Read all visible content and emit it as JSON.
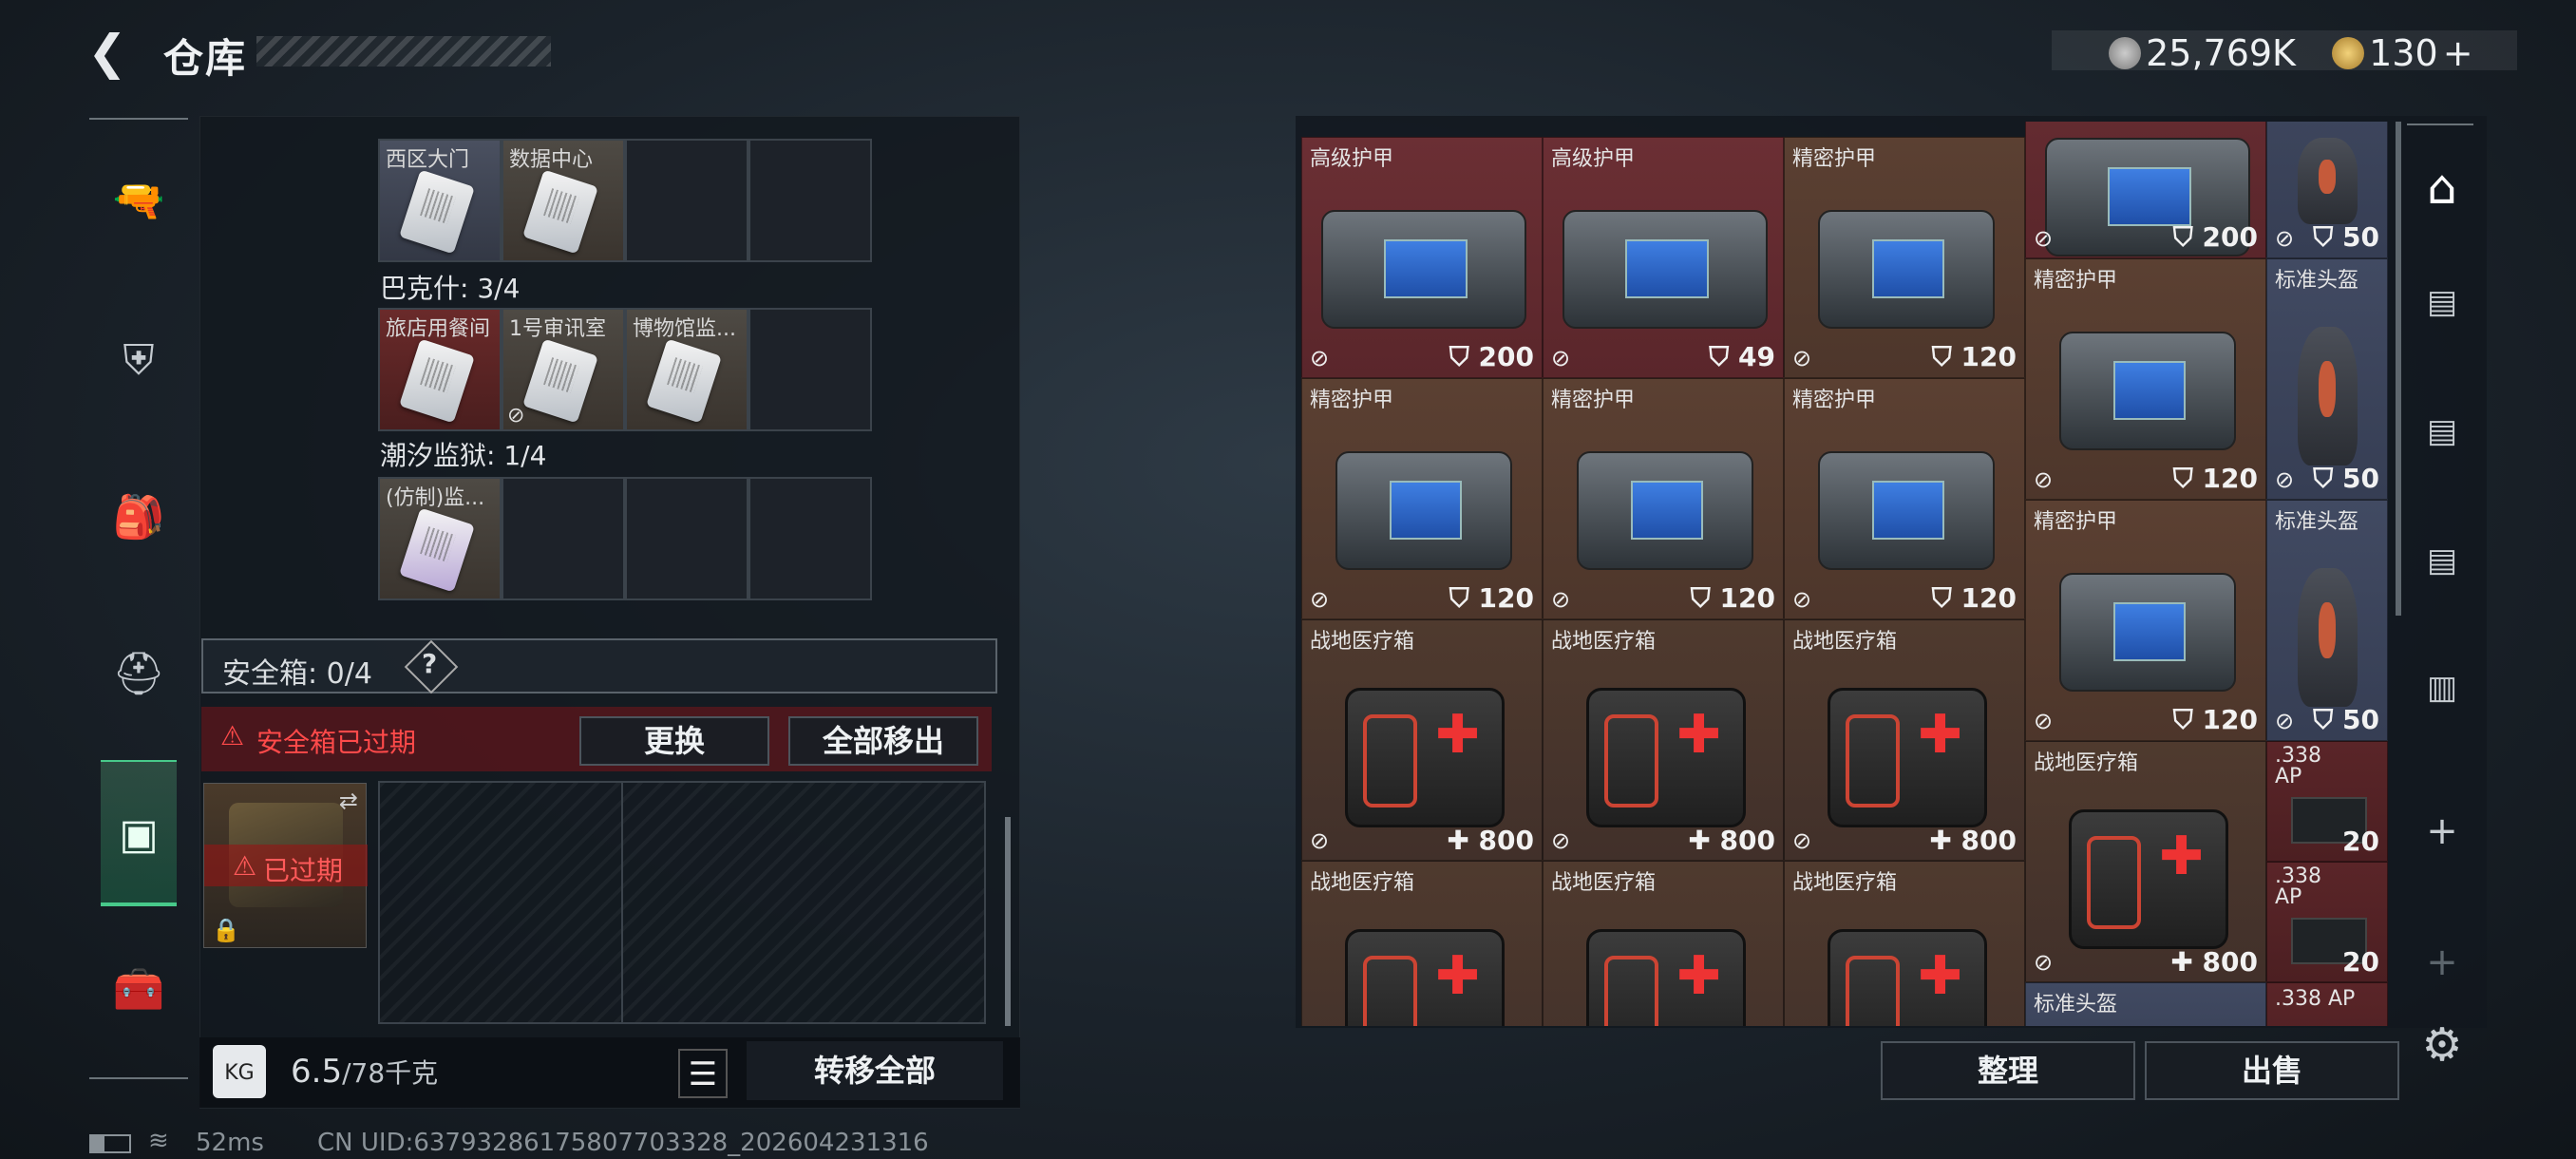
{
  "header": {
    "back_icon": "back-arrow-icon",
    "title": "仓库",
    "currency1": "25,769K",
    "currency2": "130",
    "currency2_add": "+"
  },
  "left_nav": {
    "items": [
      {
        "icon": "gun-icon",
        "glyph": "🔫"
      },
      {
        "icon": "armor-vest-icon",
        "glyph": "⛨"
      },
      {
        "icon": "backpack-icon",
        "glyph": "🎒"
      },
      {
        "icon": "helmet-icon",
        "glyph": "⛑"
      },
      {
        "icon": "safe-box-icon",
        "glyph": "▣"
      },
      {
        "icon": "toolbox-icon",
        "glyph": "🧰"
      }
    ]
  },
  "keycards": {
    "top_slots": [
      "西区大门",
      "数据中心"
    ],
    "group2_label": "巴克什: 3/4",
    "group2_slots": [
      "旅店用餐间",
      "1号审讯室",
      "博物馆监..."
    ],
    "group3_label": "潮汐监狱: 1/4",
    "group3_slots": [
      "(仿制)监..."
    ]
  },
  "safebox": {
    "label": "安全箱: 0/4",
    "help": "?",
    "expired_warning": "安全箱已过期",
    "replace_button": "更换",
    "move_all_button": "全部移出",
    "expired_badge": "已过期"
  },
  "footer_left": {
    "weight_value": "6.5",
    "weight_max": "/78千克",
    "transfer_all": "转移全部"
  },
  "footer_right": {
    "sort_button": "整理",
    "sell_button": "出售"
  },
  "status": {
    "ping": "52ms",
    "uid": "CN UID:63793286175807703328_202604231316"
  },
  "storage_items": [
    {
      "name": "高级护甲",
      "value": "200",
      "kind": "armor"
    },
    {
      "name": "高级护甲",
      "value": "49",
      "kind": "armor"
    },
    {
      "name": "精密护甲",
      "value": "120",
      "kind": "armor2"
    },
    {
      "name": "精密护甲",
      "value": "120",
      "kind": "armor2"
    },
    {
      "name": "精密护甲",
      "value": "120",
      "kind": "armor2"
    },
    {
      "name": "精密护甲",
      "value": "120",
      "kind": "armor2"
    },
    {
      "name": "战地医疗箱",
      "value": "800",
      "kind": "med"
    },
    {
      "name": "战地医疗箱",
      "value": "800",
      "kind": "med"
    },
    {
      "name": "战地医疗箱",
      "value": "800",
      "kind": "med"
    },
    {
      "name": "战地医疗箱",
      "value": "",
      "kind": "med"
    },
    {
      "name": "战地医疗箱",
      "value": "",
      "kind": "med"
    },
    {
      "name": "战地医疗箱",
      "value": "",
      "kind": "med"
    },
    {
      "name": "",
      "value": "200",
      "kind": "armor"
    },
    {
      "name": "精密护甲",
      "value": "120",
      "kind": "armor2"
    },
    {
      "name": "精密护甲",
      "value": "120",
      "kind": "armor2"
    },
    {
      "name": "战地医疗箱",
      "value": "800",
      "kind": "med"
    },
    {
      "name": "标准头盔",
      "value": "",
      "kind": "helm"
    },
    {
      "name": "",
      "value": "50",
      "kind": "helm"
    },
    {
      "name": "标准头盔",
      "value": "50",
      "kind": "helm"
    },
    {
      "name": "标准头盔",
      "value": "50",
      "kind": "helm"
    },
    {
      "name": ".338 AP",
      "value": "20",
      "kind": "ammo"
    },
    {
      "name": ".338 AP",
      "value": "20",
      "kind": "ammo"
    },
    {
      "name": ".338 AP",
      "value": "",
      "kind": "ammo"
    }
  ],
  "colors": {
    "accent_green": "#47c98a",
    "warning_red": "#e04040",
    "armor_bg": "#6b2f34",
    "helmet_bg": "#414a62"
  }
}
